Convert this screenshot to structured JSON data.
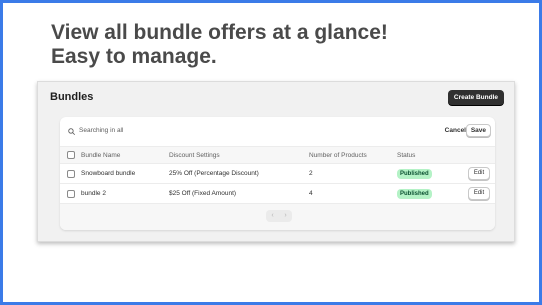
{
  "headline": {
    "line1": "View all bundle offers at a glance!",
    "line2": "Easy to manage."
  },
  "panel": {
    "title": "Bundles",
    "create_button": "Create Bundle"
  },
  "search": {
    "text": "Searching in all",
    "cancel_label": "Cancel",
    "save_label": "Save"
  },
  "table": {
    "columns": [
      "Bundle Name",
      "Discount Settings",
      "Number of Products",
      "Status"
    ],
    "rows": [
      {
        "name": "Snowboard bundle",
        "discount": "25% Off (Percentage Discount)",
        "products": "2",
        "status": "Published",
        "action": "Edit"
      },
      {
        "name": "bundle 2",
        "discount": "$25 Off (Fixed Amount)",
        "products": "4",
        "status": "Published",
        "action": "Edit"
      }
    ]
  },
  "pagination": {
    "prev_icon": "chevron-left-icon",
    "next_icon": "chevron-right-icon",
    "prev_glyph": "‹",
    "next_glyph": "›"
  },
  "colors": {
    "frame_border": "#3b7be8",
    "primary_button": "#303030",
    "published_badge": "#b4f2c6",
    "published_text": "#0c5132"
  }
}
